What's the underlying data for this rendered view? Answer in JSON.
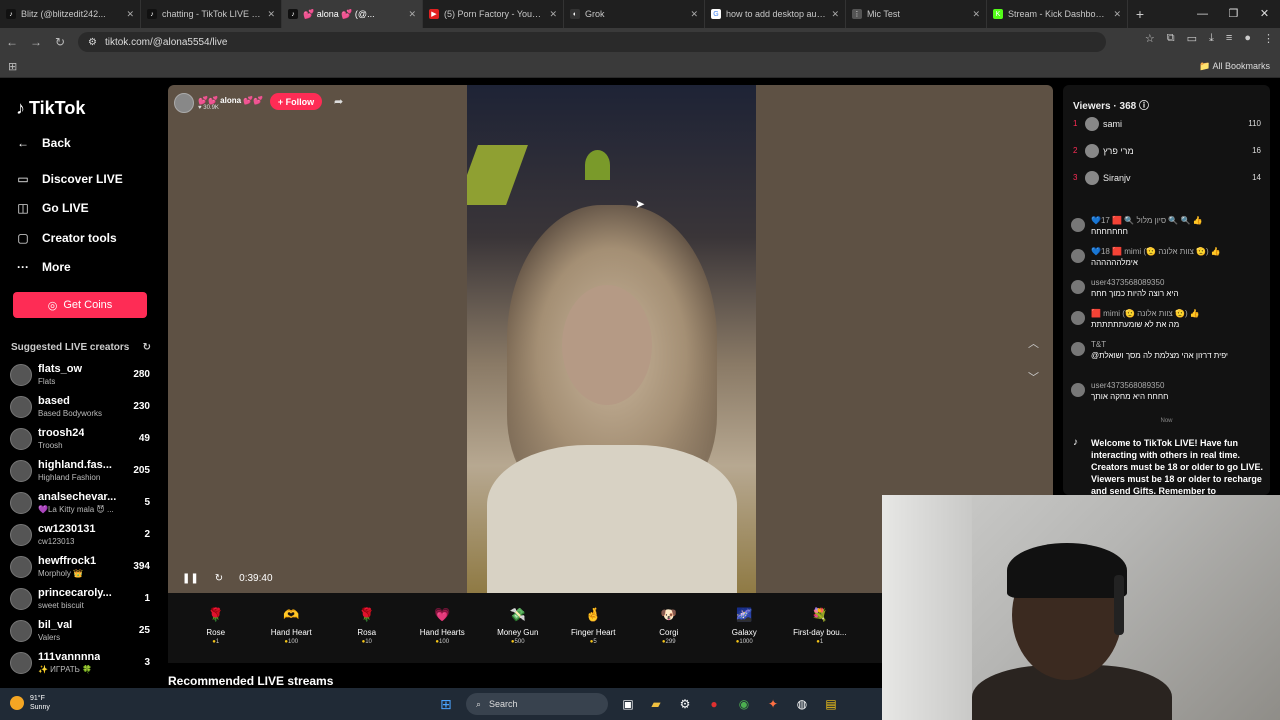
{
  "tabs": [
    {
      "title": "Blitz (@blitzedit242...",
      "icon": "tiktok",
      "active": false
    },
    {
      "title": "chatting - TikTok LIVE stre...",
      "icon": "tiktok",
      "active": false
    },
    {
      "title": "💕 alona 💕 (@...",
      "icon": "tiktok",
      "active": true
    },
    {
      "title": "(5) Porn Factory - YouTube",
      "icon": "youtube",
      "active": false
    },
    {
      "title": "Grok",
      "icon": "grok",
      "active": false
    },
    {
      "title": "how to add desktop audio",
      "icon": "google",
      "active": false
    },
    {
      "title": "Mic Test",
      "icon": "mic",
      "active": false
    },
    {
      "title": "Stream - Kick Dashboard",
      "icon": "kick",
      "active": false
    }
  ],
  "address": {
    "url": "tiktok.com/@alona5554/live"
  },
  "bookmarks": {
    "all_label": "All Bookmarks"
  },
  "sidebar": {
    "logo": "TikTok",
    "back": "Back",
    "nav": [
      {
        "label": "Discover LIVE",
        "icon": "broadcast-icon"
      },
      {
        "label": "Go LIVE",
        "icon": "camera-icon"
      },
      {
        "label": "Creator tools",
        "icon": "tools-icon"
      },
      {
        "label": "More",
        "icon": "more-icon"
      }
    ],
    "coins_label": "Get Coins",
    "suggested_title": "Suggested LIVE creators",
    "creators": [
      {
        "name": "flats_ow",
        "sub": "Flats",
        "count": "280"
      },
      {
        "name": "based",
        "sub": "Based Bodyworks",
        "count": "230"
      },
      {
        "name": "troosh24",
        "sub": "Troosh",
        "count": "49"
      },
      {
        "name": "highland.fas...",
        "sub": "Highland Fashion",
        "count": "205"
      },
      {
        "name": "analsechevar...",
        "sub": "💜La Kitty mala 😈 ...",
        "count": "5"
      },
      {
        "name": "cw1230131",
        "sub": "cw123013",
        "count": "2"
      },
      {
        "name": "hewffrock1",
        "sub": "Morpholy 👑",
        "count": "394"
      },
      {
        "name": "princecaroly...",
        "sub": "sweet biscuit",
        "count": "1"
      },
      {
        "name": "bil_val",
        "sub": "Valers",
        "count": "25"
      },
      {
        "name": "111vannnna",
        "sub": "✨ ИГРАТЬ 🍀",
        "count": "3"
      }
    ]
  },
  "stream": {
    "host_name": "💕💕 alona 💕💕",
    "host_likes": "♥ 30.9K",
    "follow_label": "+ Follow",
    "time": "0:39:40"
  },
  "gifts": [
    {
      "name": "Rose",
      "price": "1",
      "icon": "🌹"
    },
    {
      "name": "Hand Heart",
      "price": "100",
      "icon": "🫶"
    },
    {
      "name": "Rosa",
      "price": "10",
      "icon": "🌹"
    },
    {
      "name": "Hand Hearts",
      "price": "100",
      "icon": "💗"
    },
    {
      "name": "Money Gun",
      "price": "500",
      "icon": "💸"
    },
    {
      "name": "Finger Heart",
      "price": "5",
      "icon": "🤞"
    },
    {
      "name": "Corgi",
      "price": "299",
      "icon": "🐶"
    },
    {
      "name": "Galaxy",
      "price": "1000",
      "icon": "🌌"
    },
    {
      "name": "First-day bou...",
      "price": "1",
      "icon": "💐"
    }
  ],
  "recommended_title": "Recommended LIVE streams",
  "viewers": {
    "title": "Viewers · 368",
    "top": [
      {
        "rank": "1",
        "name": "sami",
        "count": "110"
      },
      {
        "rank": "2",
        "name": "מרי פרץ",
        "count": "16"
      },
      {
        "rank": "3",
        "name": "Siranjv",
        "count": "14"
      }
    ]
  },
  "chat": [
    {
      "user": "💙17 🟥 🔍 סיון מלול 🔍 🔍 👍",
      "text": "חחחחחחח"
    },
    {
      "user": "💙18 🟥 mimi (🫡 צוות אלונה 🫡) 👍",
      "text": "אימלהההההה"
    },
    {
      "user": "user4373568089350",
      "text": "היא רוצה להיות כמוך חחח"
    },
    {
      "user": "🟥 mimi (🫡 צוות אלונה 🫡) 👍",
      "text": "מה את לא שומעתתתתתת"
    },
    {
      "user": "T&T",
      "text": "@יפית דרזון אהי מצלמת לה מסך ושואלת"
    },
    {
      "user": "user4373568089350",
      "text": "חחחח היא מחקה אותך"
    }
  ],
  "chat_divider": "Now",
  "welcome": "Welcome to TikTok LIVE! Have fun interacting with others in real time. Creators must be 18 or older to go LIVE. Viewers must be 18 or older to recharge and send Gifts. Remember to",
  "taskbar": {
    "temp": "91°F",
    "condition": "Sunny",
    "search": "Search"
  }
}
